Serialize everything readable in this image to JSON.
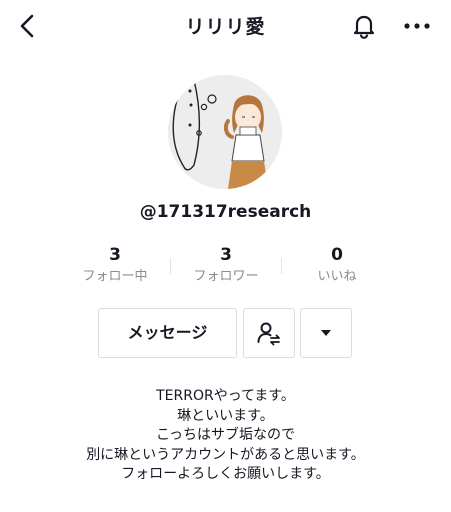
{
  "header": {
    "title": "リリリ愛"
  },
  "profile": {
    "username": "@171317research"
  },
  "stats": [
    {
      "value": "3",
      "label": "フォロー中"
    },
    {
      "value": "3",
      "label": "フォロワー"
    },
    {
      "value": "0",
      "label": "いいね"
    }
  ],
  "actions": {
    "message_label": "メッセージ"
  },
  "bio": [
    "TERRORやってます。",
    "琳といいます。",
    "こっちはサブ垢なので",
    "別に琳というアカウントがあると思います。",
    "フォローよろしくお願いします。"
  ],
  "icons": {
    "back": "chevron-left-icon",
    "bell": "bell-icon",
    "more": "more-horizontal-icon",
    "friend": "add-friend-icon",
    "dropdown": "triangle-down-icon"
  }
}
